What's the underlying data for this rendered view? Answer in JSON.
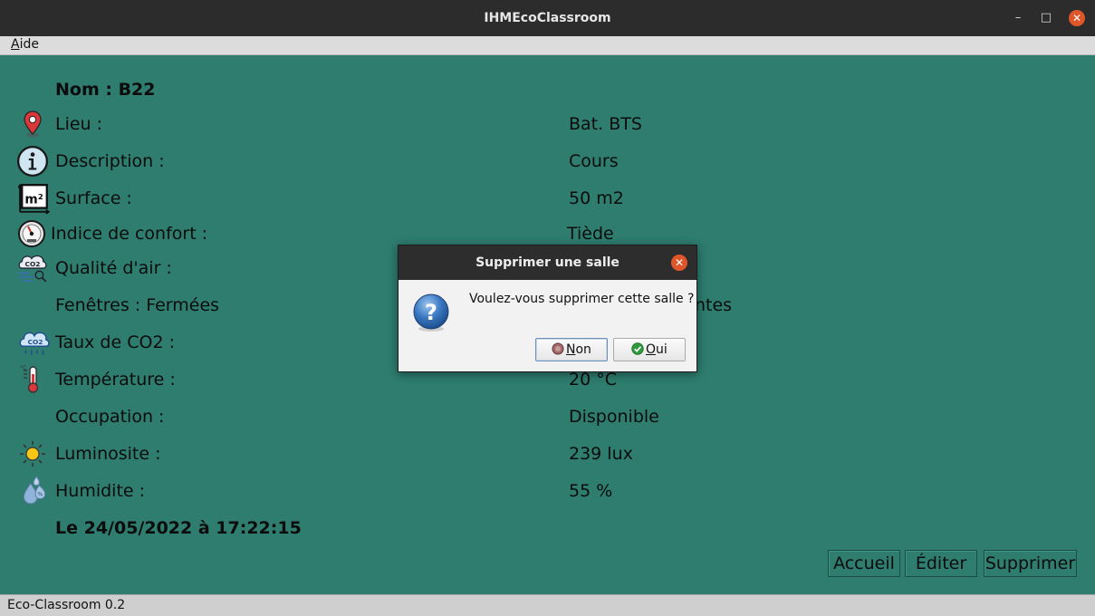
{
  "window": {
    "title": "IHMEcoClassroom"
  },
  "menu": {
    "items": [
      {
        "label_rest": "ide",
        "mnemonic": "A"
      }
    ]
  },
  "room": {
    "name": "Nom : B22",
    "rows": [
      {
        "label": "Lieu :",
        "value": "Bat. BTS",
        "icon": "location-pin-icon"
      },
      {
        "label": "Description  :",
        "value": "Cours",
        "icon": "info-icon"
      },
      {
        "label": "Surface :",
        "value": "50 m2",
        "icon": "area-m2-icon"
      },
      {
        "label": "Indice de confort :",
        "value": "Tiède",
        "icon": "gauge-icon"
      },
      {
        "label": "Qualité d'air :",
        "value": "",
        "icon": "co2-cloud-icon"
      },
      {
        "label": "Fenêtres : Fermées",
        "value": "ntes",
        "icon": ""
      },
      {
        "label": "Taux de CO2 :",
        "value": "",
        "icon": "co2-icon"
      },
      {
        "label": "Température :",
        "value": "20 °C",
        "icon": "thermometer-icon"
      },
      {
        "label": "Occupation :",
        "value": "Disponible",
        "icon": ""
      },
      {
        "label": "Luminosite :",
        "value": "239 lux",
        "icon": "sun-icon"
      },
      {
        "label": "Humidite :",
        "value": "55 %",
        "icon": "humidity-icon"
      }
    ],
    "timestamp": "Le 24/05/2022 à 17:22:15"
  },
  "buttons": {
    "home": "Accueil",
    "edit": "Éditer",
    "delete": "Supprimer"
  },
  "status": {
    "text": "Eco-Classroom 0.2"
  },
  "dialog": {
    "title": "Supprimer une salle",
    "message": "Voulez-vous supprimer cette salle ?",
    "no_mnemonic": "N",
    "no_rest": "on",
    "yes_mnemonic": "O",
    "yes_rest": "ui"
  },
  "colors": {
    "background": "#2e7d6f",
    "close": "#e0562b"
  }
}
